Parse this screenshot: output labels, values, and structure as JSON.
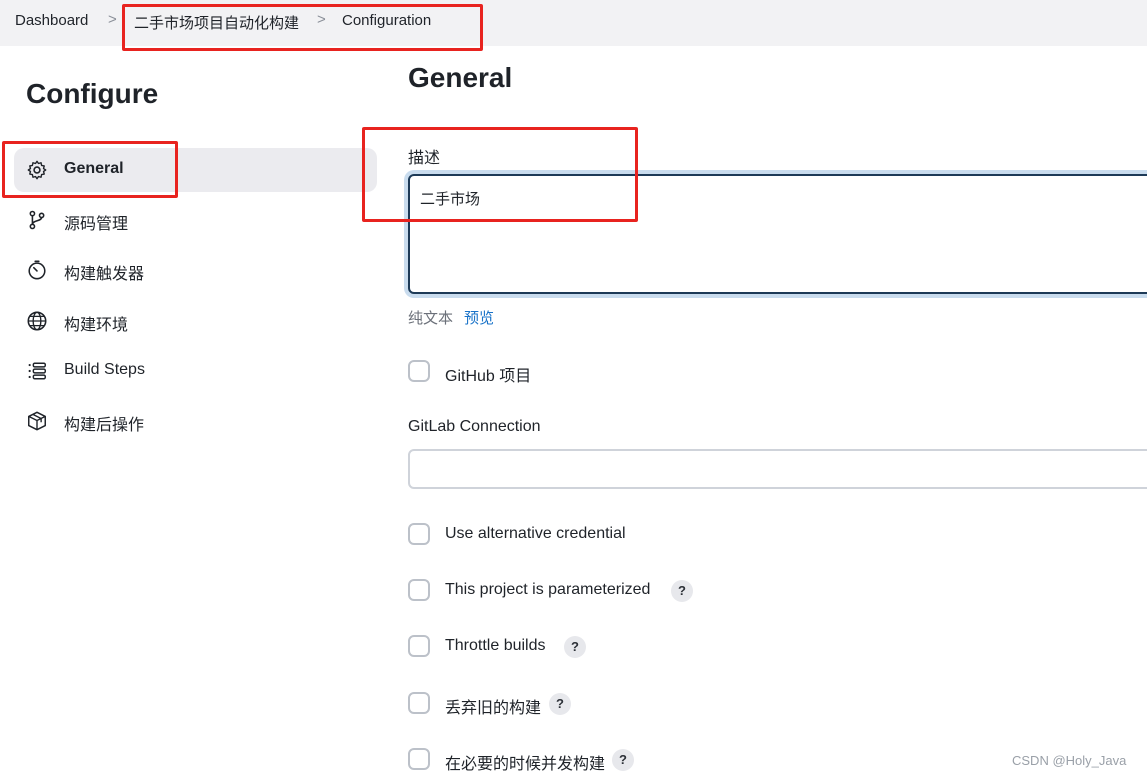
{
  "breadcrumb": {
    "items": [
      "Dashboard",
      "二手市场项目自动化构建",
      "Configuration"
    ],
    "separator": ">"
  },
  "sidebar": {
    "title": "Configure",
    "items": [
      {
        "label": "General",
        "icon": "gear-icon",
        "active": true
      },
      {
        "label": "源码管理",
        "icon": "branch-icon"
      },
      {
        "label": "构建触发器",
        "icon": "timer-icon"
      },
      {
        "label": "构建环境",
        "icon": "globe-icon"
      },
      {
        "label": "Build Steps",
        "icon": "list-icon"
      },
      {
        "label": "构建后操作",
        "icon": "package-icon"
      }
    ]
  },
  "main": {
    "title": "General",
    "description": {
      "label": "描述",
      "value": "二手市场",
      "plain_text": "纯文本",
      "preview": "预览"
    },
    "github": {
      "label": "GitHub 项目"
    },
    "gitlab": {
      "label": "GitLab Connection",
      "value": ""
    },
    "options": [
      {
        "label": "Use alternative credential",
        "help": false
      },
      {
        "label": "This project is parameterized",
        "help": true
      },
      {
        "label": "Throttle builds",
        "help": true
      },
      {
        "label": "丢弃旧的构建",
        "help": true
      },
      {
        "label": "在必要的时候并发构建",
        "help": true
      }
    ],
    "help_symbol": "?"
  },
  "watermark": "CSDN @Holy_Java",
  "colors": {
    "annotation_red": "#e8231f",
    "link_blue": "#1a73c8",
    "focus_border": "#1d3a57"
  }
}
